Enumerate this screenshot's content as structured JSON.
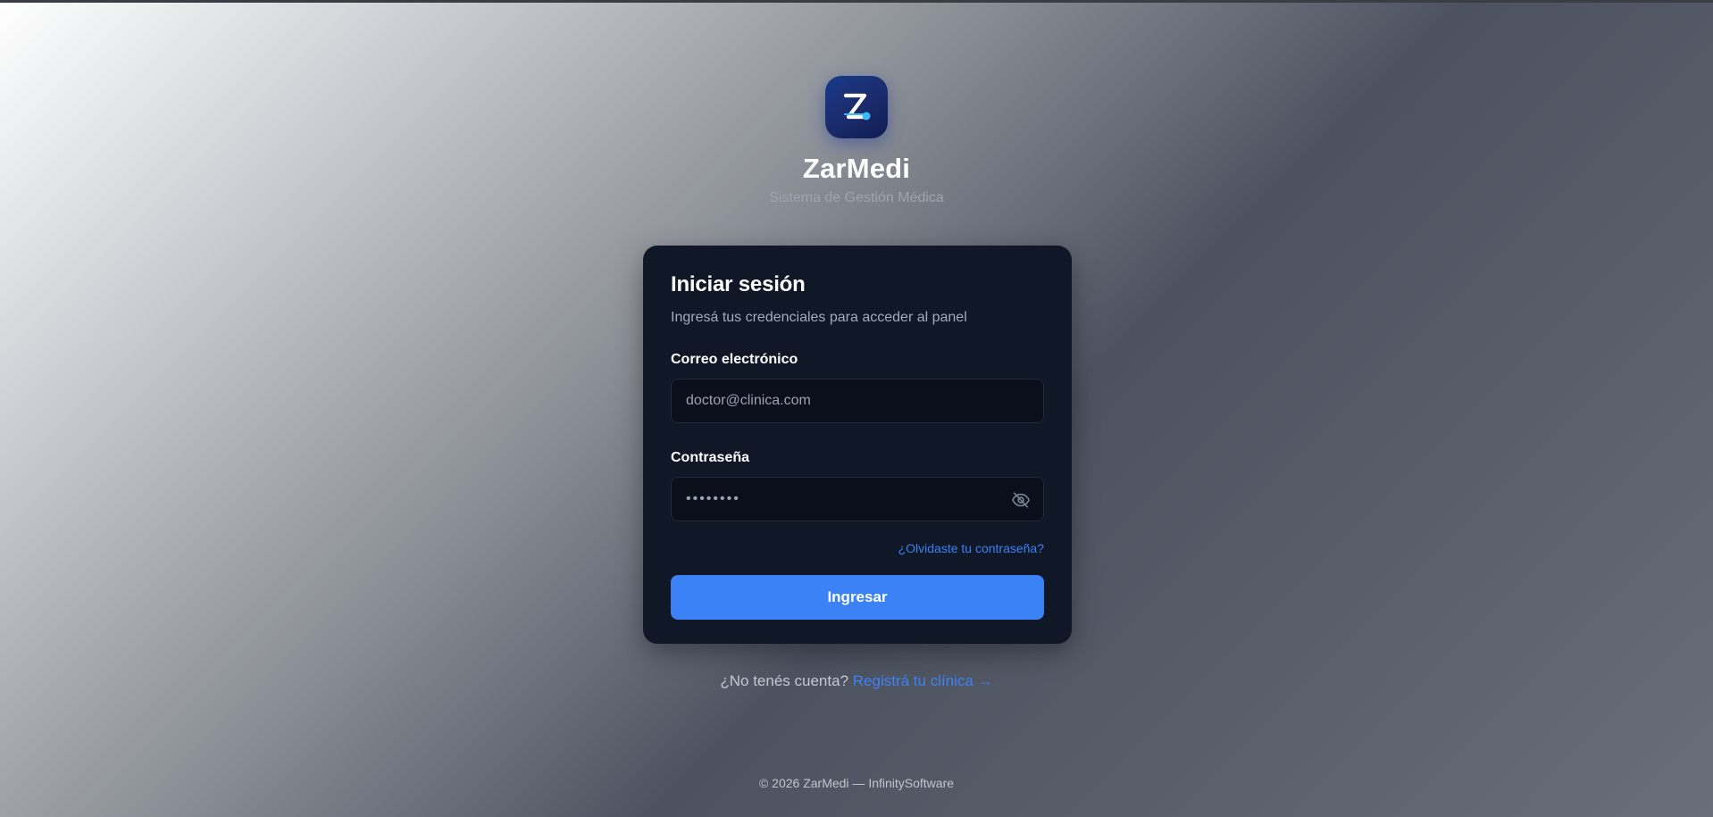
{
  "brand": {
    "logo_icon": "z-logo-icon",
    "name": "ZarMedi",
    "tagline": "Sistema de Gestión Médica"
  },
  "login": {
    "title": "Iniciar sesión",
    "subtitle": "Ingresá tus credenciales para acceder al panel",
    "email_label": "Correo electrónico",
    "email_placeholder": "doctor@clinica.com",
    "password_label": "Contraseña",
    "password_value": "••••••••",
    "password_toggle_icon": "eye-off-icon",
    "forgot_link": "¿Olvidaste tu contraseña?",
    "submit_label": "Ingresar"
  },
  "signup": {
    "prompt": "¿No tenés cuenta?",
    "link": "Registrá tu clínica →"
  },
  "footer": {
    "text": "© 2026 ZarMedi — InfinitySoftware"
  },
  "colors": {
    "accent": "#3b82f6",
    "card_bg": "#101828",
    "input_bg": "#0a0f1a"
  }
}
